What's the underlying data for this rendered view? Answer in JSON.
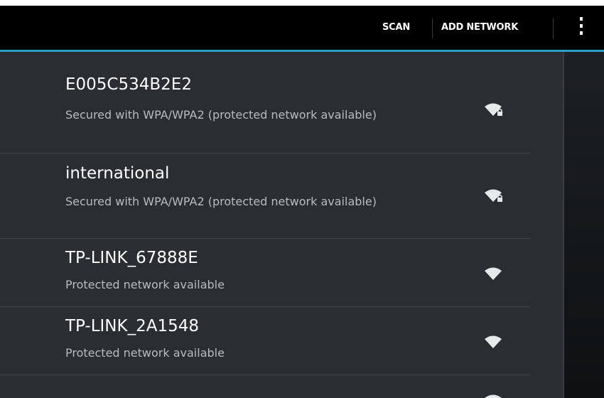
{
  "action_bar": {
    "scan_label": "SCAN",
    "add_network_label": "ADD NETWORK",
    "overflow_icon": "overflow-menu-icon"
  },
  "networks": [
    {
      "ssid": "E005C534B2E2",
      "status": "Secured with WPA/WPA2 (protected network available)",
      "icon": "wifi-lock-icon"
    },
    {
      "ssid": "international",
      "status": "Secured with WPA/WPA2 (protected network available)",
      "icon": "wifi-lock-icon"
    },
    {
      "ssid": "TP-LINK_67888E",
      "status": "Protected network available",
      "icon": "wifi-icon"
    },
    {
      "ssid": "TP-LINK_2A1548",
      "status": "Protected network available",
      "icon": "wifi-icon"
    }
  ],
  "colors": {
    "accent": "#2e9ec4",
    "list_background": "#2a2d31",
    "action_bar": "#000000"
  }
}
